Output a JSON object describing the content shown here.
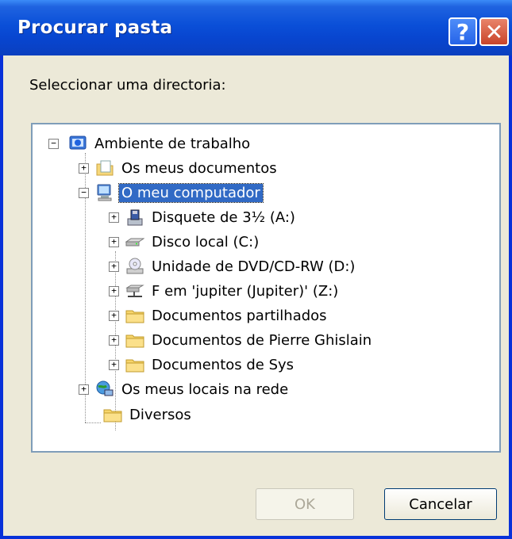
{
  "window": {
    "title": "Procurar pasta"
  },
  "dialog": {
    "prompt": "Seleccionar uma directoria:",
    "ok_label": "OK",
    "cancel_label": "Cancelar"
  },
  "tree": {
    "items": [
      {
        "label": "Ambiente de trabalho",
        "icon": "desktop-icon",
        "expander": "−"
      },
      {
        "label": "Os meus documentos",
        "icon": "documents-icon",
        "expander": "+"
      },
      {
        "label": "O meu computador",
        "icon": "computer-icon",
        "expander": "−",
        "selected": true
      },
      {
        "label": "Disquete de 3½ (A:)",
        "icon": "floppy-icon",
        "expander": "+"
      },
      {
        "label": "Disco local (C:)",
        "icon": "hard-drive-icon",
        "expander": "+"
      },
      {
        "label": "Unidade de DVD/CD-RW (D:)",
        "icon": "dvd-drive-icon",
        "expander": "+"
      },
      {
        "label": "F em 'jupiter (Jupiter)' (Z:)",
        "icon": "network-drive-icon",
        "expander": "+"
      },
      {
        "label": "Documentos partilhados",
        "icon": "folder-icon",
        "expander": "+"
      },
      {
        "label": "Documentos de Pierre Ghislain",
        "icon": "folder-icon",
        "expander": "+"
      },
      {
        "label": "Documentos de Sys",
        "icon": "folder-icon",
        "expander": "+"
      },
      {
        "label": "Os meus locais na rede",
        "icon": "network-places-icon",
        "expander": "+"
      },
      {
        "label": "Diversos",
        "icon": "folder-icon",
        "expander": ""
      }
    ]
  },
  "colors": {
    "titlebar": "#0a4fd8",
    "selection": "#316ac5",
    "dialog_bg": "#ece9d8"
  }
}
